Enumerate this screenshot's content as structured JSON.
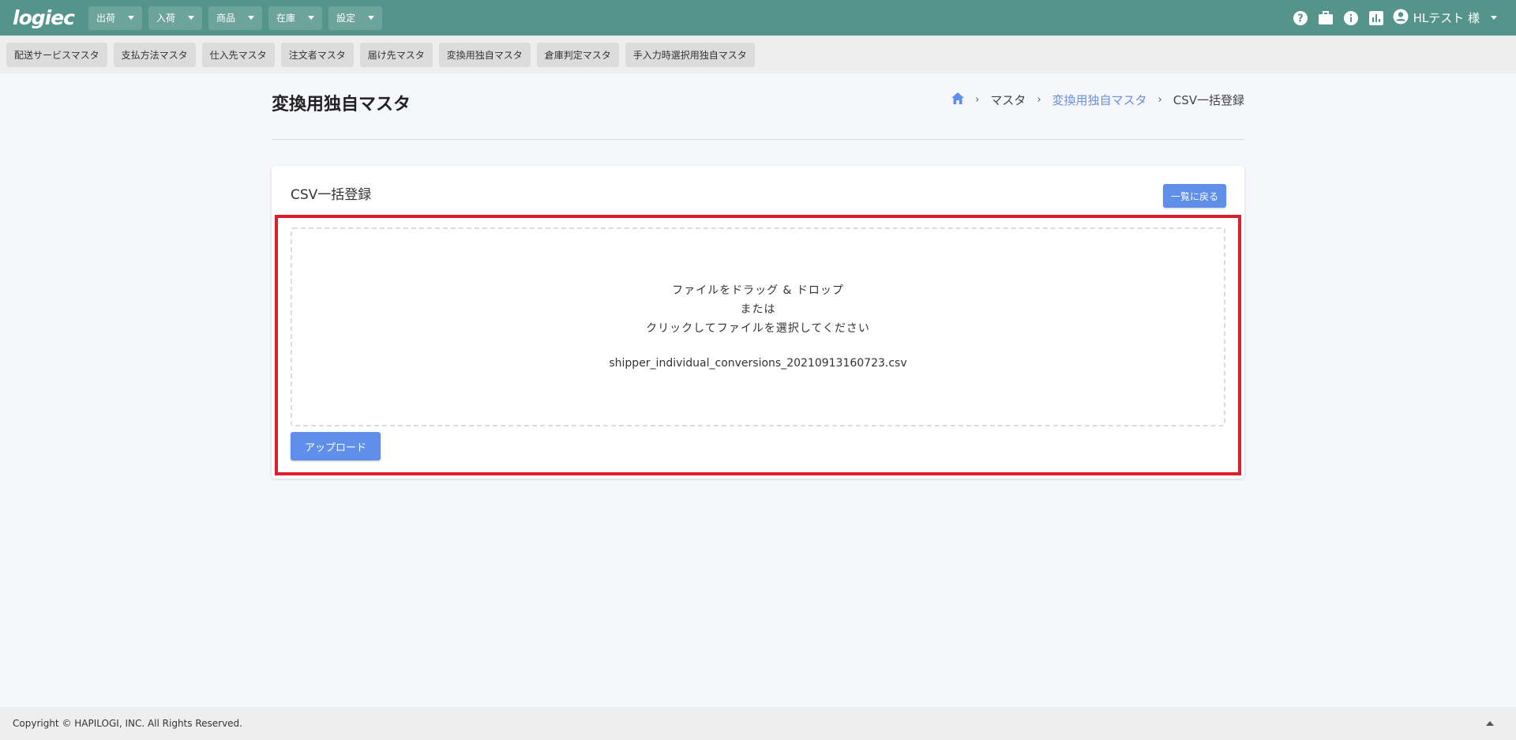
{
  "brand": {
    "logo": "logiec"
  },
  "nav": {
    "menus": [
      {
        "label": "出荷"
      },
      {
        "label": "入荷"
      },
      {
        "label": "商品"
      },
      {
        "label": "在庫"
      },
      {
        "label": "設定"
      }
    ],
    "user": {
      "label": "HLテスト 様"
    },
    "icons": [
      "help-icon",
      "briefcase-icon",
      "info-icon",
      "chart-icon",
      "account-icon"
    ]
  },
  "subnav": {
    "items": [
      {
        "label": "配送サービスマスタ"
      },
      {
        "label": "支払方法マスタ"
      },
      {
        "label": "仕入先マスタ"
      },
      {
        "label": "注文者マスタ"
      },
      {
        "label": "届け先マスタ"
      },
      {
        "label": "変換用独自マスタ"
      },
      {
        "label": "倉庫判定マスタ"
      },
      {
        "label": "手入力時選択用独自マスタ"
      }
    ]
  },
  "page": {
    "title": "変換用独自マスタ",
    "breadcrumb": {
      "master": "マスタ",
      "current_parent": "変換用独自マスタ",
      "current": "CSV一括登録"
    }
  },
  "card": {
    "title": "CSV一括登録",
    "back_label": "一覧に戻る",
    "dropzone": {
      "line1": "ファイルをドラッグ & ドロップ",
      "line2": "または",
      "line3": "クリックしてファイルを選択してください",
      "file_name": "shipper_individual_conversions_20210913160723.csv"
    },
    "upload_label": "アップロード"
  },
  "footer": {
    "copyright": "Copyright © HAPILOGI, INC. All Rights Reserved."
  },
  "colors": {
    "topbar": "#54948a",
    "primary_button": "#5f8fe8",
    "highlight_border": "#e01e2b",
    "link": "#6a8fe0"
  }
}
